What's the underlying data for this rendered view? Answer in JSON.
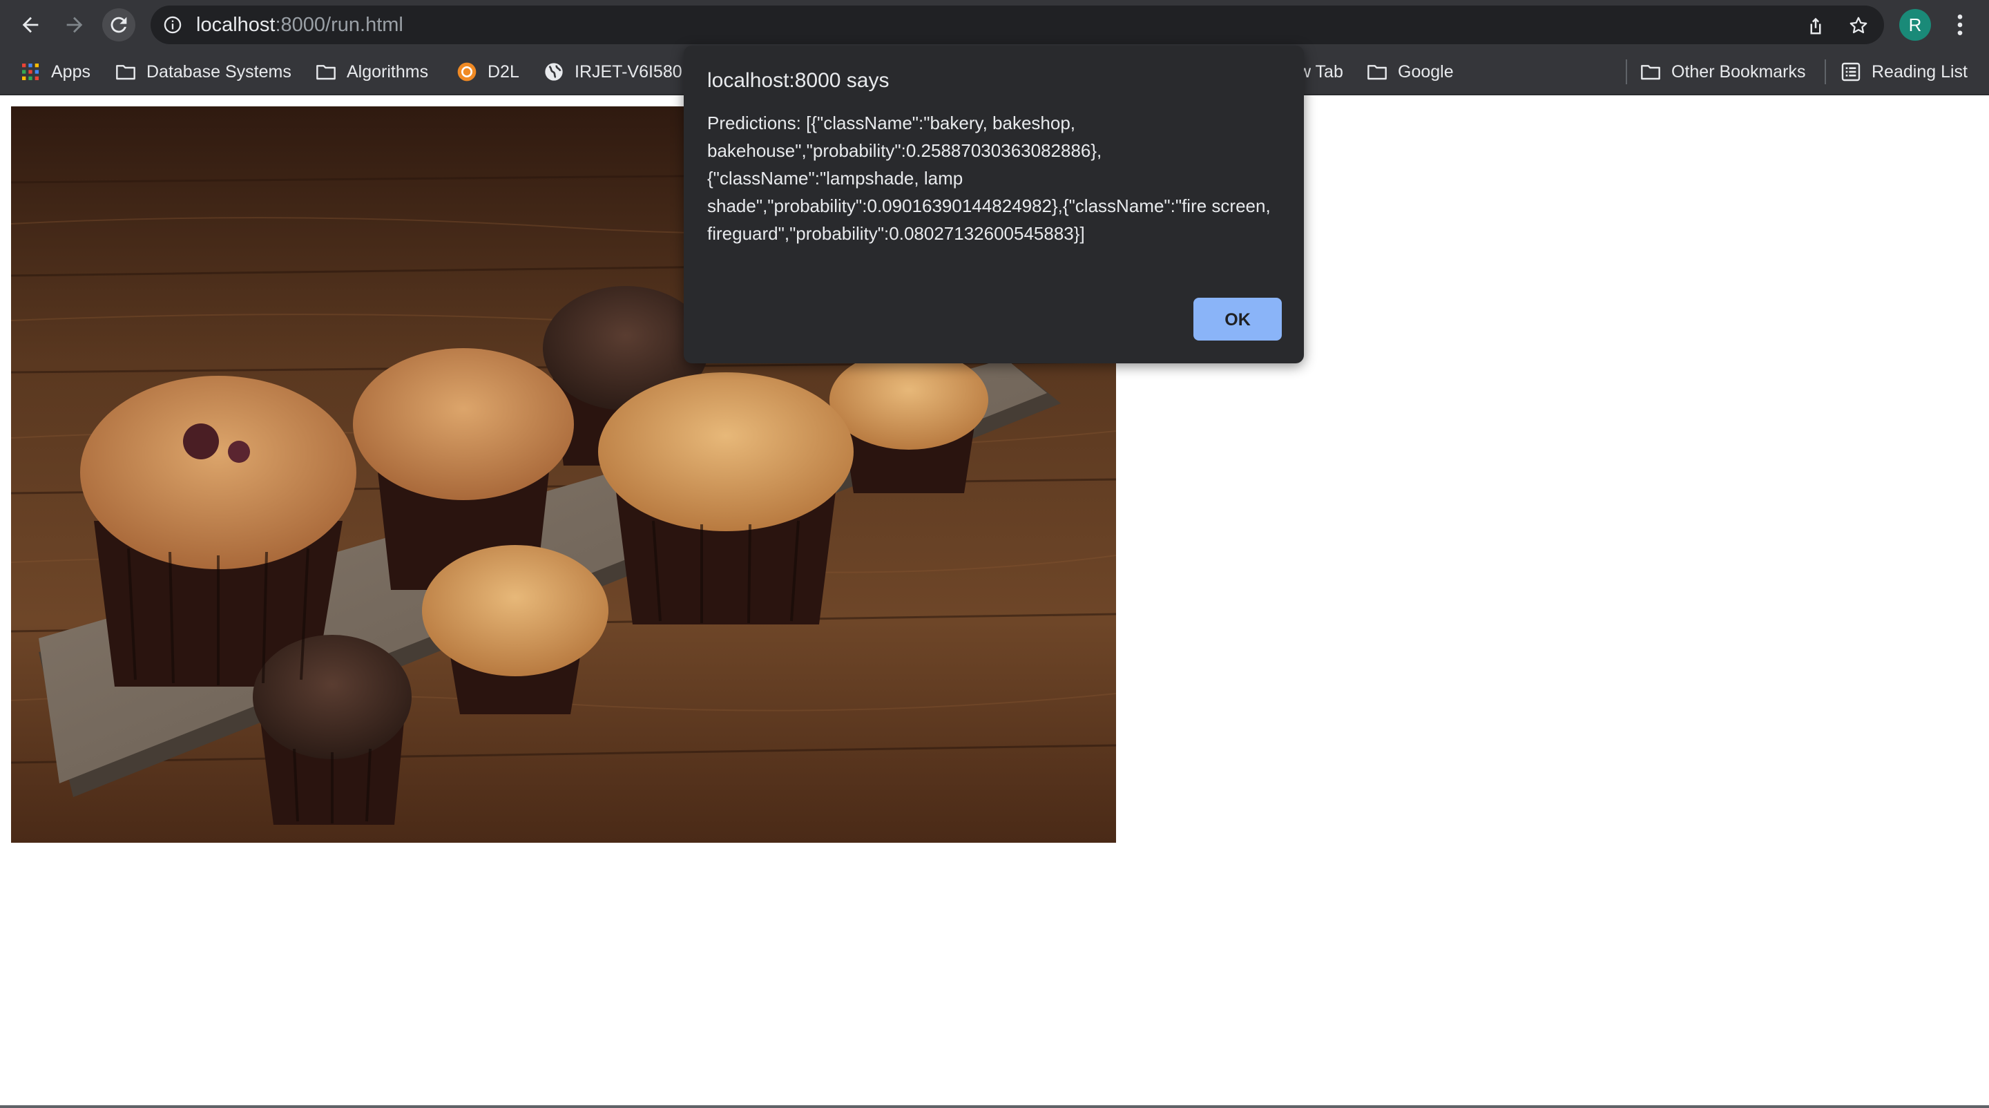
{
  "browser": {
    "url_host": "localhost",
    "url_rest": ":8000/run.html",
    "profile_initial": "R",
    "icons": {
      "back": "arrow-left-icon",
      "forward": "arrow-right-icon",
      "reload": "reload-icon",
      "site_info": "info-icon",
      "share": "share-icon",
      "bookmark": "star-icon",
      "menu": "kebab-menu-icon"
    }
  },
  "bookmarks": {
    "items": [
      {
        "label": "Apps",
        "icon": "apps-grid-icon"
      },
      {
        "label": "Database Systems",
        "icon": "folder-icon"
      },
      {
        "label": "Algorithms",
        "icon": "folder-icon"
      },
      {
        "label": "D2L",
        "icon": "d2l-icon"
      },
      {
        "label": "IRJET-V6I580",
        "icon": "globe-icon"
      },
      {
        "label": "w Tab",
        "icon": ""
      },
      {
        "label": "Google",
        "icon": "folder-icon"
      }
    ],
    "other_bookmarks": "Other Bookmarks",
    "reading_list": "Reading List"
  },
  "dialog": {
    "title": "localhost:8000 says",
    "message": "Predictions: [{\"className\":\"bakery, bakeshop, bakehouse\",\"probability\":0.25887030363082886},{\"className\":\"lampshade, lamp shade\",\"probability\":0.09016390144824982},{\"className\":\"fire screen, fireguard\",\"probability\":0.08027132600545883}]",
    "ok_label": "OK"
  },
  "content": {
    "image_subject": "muffins on a wooden serving board",
    "colors": {
      "wood_dark": "#3f2414",
      "wood_mid": "#6b4326",
      "board": "#7a6e61",
      "muffin_top": "#c98a4f",
      "muffin_crumb": "#d9a467",
      "chocolate": "#3e2a22",
      "liner": "#2a140f"
    }
  },
  "theme": {
    "toolbar_bg": "#35363a",
    "omnibox_bg": "#202124",
    "dialog_bg": "#292a2d",
    "accent": "#8ab4f8",
    "text": "#e8eaed"
  }
}
